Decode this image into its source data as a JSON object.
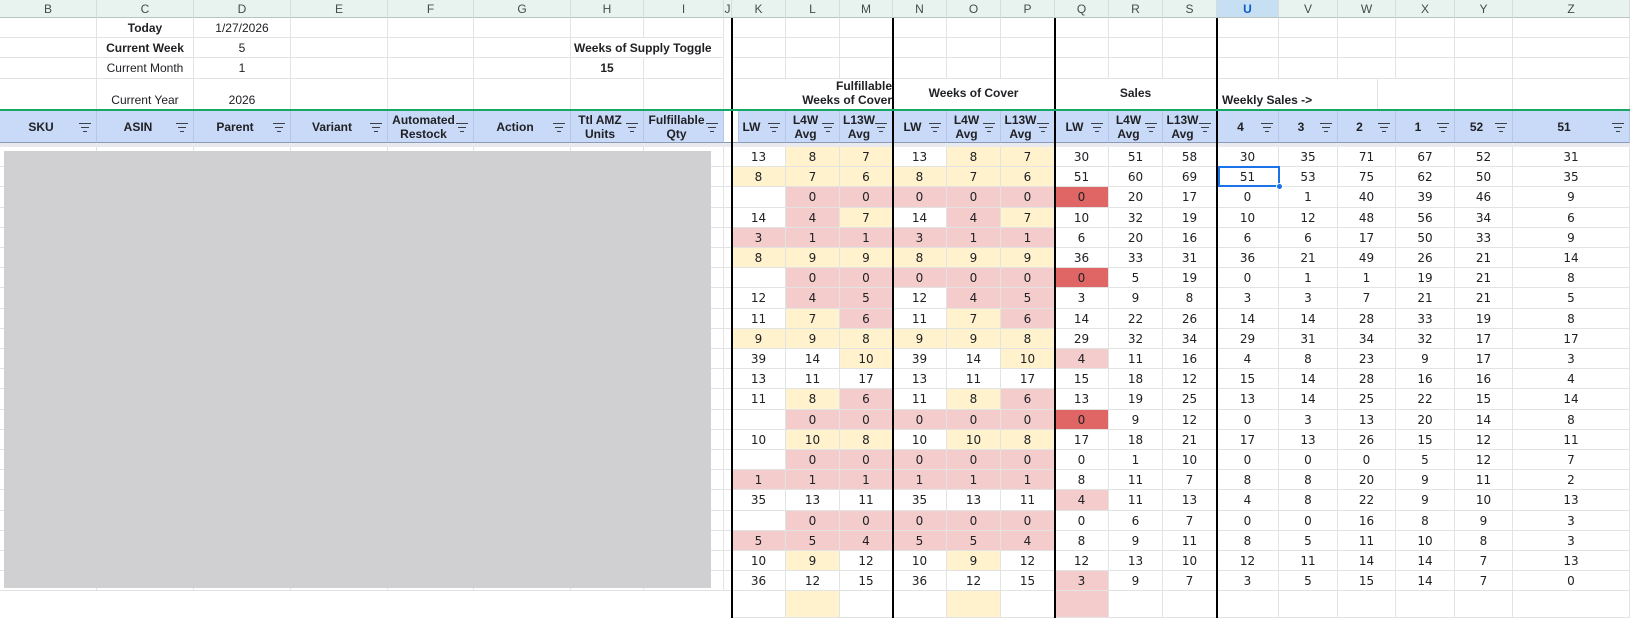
{
  "columns": [
    "B",
    "C",
    "D",
    "E",
    "F",
    "G",
    "H",
    "I",
    "J",
    "K",
    "L",
    "M",
    "N",
    "O",
    "P",
    "Q",
    "R",
    "S",
    "U",
    "V",
    "W",
    "X",
    "Y",
    "Z"
  ],
  "selected_column": "U",
  "info": {
    "today_label": "Today",
    "today_value": "1/27/2026",
    "week_label": "Current Week",
    "week_value": "5",
    "month_label": "Current Month",
    "month_value": "1",
    "year_label": "Current Year",
    "year_value": "2026",
    "wos_toggle_label": "Weeks of Supply Toggle",
    "wos_toggle_value": "15"
  },
  "groups": {
    "fulfillable_line1": "Fulfillable",
    "fulfillable_line2": "Weeks of Cover",
    "weeks_of_cover": "Weeks of Cover",
    "sales": "Sales",
    "weekly_sales": "Weekly Sales ->"
  },
  "headers": [
    {
      "col": "B",
      "label": "SKU"
    },
    {
      "col": "C",
      "label": "ASIN"
    },
    {
      "col": "D",
      "label": "Parent"
    },
    {
      "col": "E",
      "label": "Variant"
    },
    {
      "col": "F",
      "label": "Automated Restock"
    },
    {
      "col": "G",
      "label": "Action"
    },
    {
      "col": "H",
      "label": "Ttl AMZ Units"
    },
    {
      "col": "I",
      "label": "Fulfillable Qty"
    },
    {
      "col": "K",
      "label": "LW"
    },
    {
      "col": "L",
      "label": "L4W Avg"
    },
    {
      "col": "M",
      "label": "L13W Avg"
    },
    {
      "col": "N",
      "label": "LW"
    },
    {
      "col": "O",
      "label": "L4W Avg"
    },
    {
      "col": "P",
      "label": "L13W Avg"
    },
    {
      "col": "Q",
      "label": "LW"
    },
    {
      "col": "R",
      "label": "L4W Avg"
    },
    {
      "col": "S",
      "label": "L13W Avg"
    },
    {
      "col": "U",
      "label": "4"
    },
    {
      "col": "V",
      "label": "3"
    },
    {
      "col": "W",
      "label": "2"
    },
    {
      "col": "X",
      "label": "1"
    },
    {
      "col": "Y",
      "label": "52"
    },
    {
      "col": "Z",
      "label": "51"
    }
  ],
  "colors": {
    "yellow": "#fff2cc",
    "pink": "#f4cccc",
    "red": "#e06666",
    "header_blue": "#c9daf8",
    "selection": "#1a73e8"
  },
  "rows": [
    {
      "K": [
        "13",
        ""
      ],
      "L": [
        "8",
        "y"
      ],
      "M": [
        "7",
        "y"
      ],
      "N": [
        "13",
        ""
      ],
      "O": [
        "8",
        "y"
      ],
      "P": [
        "7",
        "y"
      ],
      "Q": [
        "30",
        ""
      ],
      "R": [
        "51",
        ""
      ],
      "S": [
        "58",
        ""
      ],
      "U": "30",
      "V": "35",
      "W": "71",
      "X": "67",
      "Y": "52",
      "Z": "31"
    },
    {
      "K": [
        "8",
        "y"
      ],
      "L": [
        "7",
        "y"
      ],
      "M": [
        "6",
        "y"
      ],
      "N": [
        "8",
        "y"
      ],
      "O": [
        "7",
        "y"
      ],
      "P": [
        "6",
        "y"
      ],
      "Q": [
        "51",
        ""
      ],
      "R": [
        "60",
        ""
      ],
      "S": [
        "69",
        ""
      ],
      "U": "51",
      "V": "53",
      "W": "75",
      "X": "62",
      "Y": "50",
      "Z": "35"
    },
    {
      "K": [
        "",
        ""
      ],
      "L": [
        "0",
        "r"
      ],
      "M": [
        "0",
        "r"
      ],
      "N": [
        "0",
        "r"
      ],
      "O": [
        "0",
        "r"
      ],
      "P": [
        "0",
        "r"
      ],
      "Q": [
        "0",
        "d"
      ],
      "R": [
        "20",
        ""
      ],
      "S": [
        "17",
        ""
      ],
      "U": "0",
      "V": "1",
      "W": "40",
      "X": "39",
      "Y": "46",
      "Z": "9"
    },
    {
      "K": [
        "14",
        ""
      ],
      "L": [
        "4",
        "r"
      ],
      "M": [
        "7",
        "y"
      ],
      "N": [
        "14",
        ""
      ],
      "O": [
        "4",
        "r"
      ],
      "P": [
        "7",
        "y"
      ],
      "Q": [
        "10",
        ""
      ],
      "R": [
        "32",
        ""
      ],
      "S": [
        "19",
        ""
      ],
      "U": "10",
      "V": "12",
      "W": "48",
      "X": "56",
      "Y": "34",
      "Z": "6"
    },
    {
      "K": [
        "3",
        "r"
      ],
      "L": [
        "1",
        "r"
      ],
      "M": [
        "1",
        "r"
      ],
      "N": [
        "3",
        "r"
      ],
      "O": [
        "1",
        "r"
      ],
      "P": [
        "1",
        "r"
      ],
      "Q": [
        "6",
        ""
      ],
      "R": [
        "20",
        ""
      ],
      "S": [
        "16",
        ""
      ],
      "U": "6",
      "V": "6",
      "W": "17",
      "X": "50",
      "Y": "33",
      "Z": "9"
    },
    {
      "K": [
        "8",
        "y"
      ],
      "L": [
        "9",
        "y"
      ],
      "M": [
        "9",
        "y"
      ],
      "N": [
        "8",
        "y"
      ],
      "O": [
        "9",
        "y"
      ],
      "P": [
        "9",
        "y"
      ],
      "Q": [
        "36",
        ""
      ],
      "R": [
        "33",
        ""
      ],
      "S": [
        "31",
        ""
      ],
      "U": "36",
      "V": "21",
      "W": "49",
      "X": "26",
      "Y": "21",
      "Z": "14"
    },
    {
      "K": [
        "",
        ""
      ],
      "L": [
        "0",
        "r"
      ],
      "M": [
        "0",
        "r"
      ],
      "N": [
        "0",
        "r"
      ],
      "O": [
        "0",
        "r"
      ],
      "P": [
        "0",
        "r"
      ],
      "Q": [
        "0",
        "d"
      ],
      "R": [
        "5",
        ""
      ],
      "S": [
        "19",
        ""
      ],
      "U": "0",
      "V": "1",
      "W": "1",
      "X": "19",
      "Y": "21",
      "Z": "8"
    },
    {
      "K": [
        "12",
        ""
      ],
      "L": [
        "4",
        "r"
      ],
      "M": [
        "5",
        "r"
      ],
      "N": [
        "12",
        ""
      ],
      "O": [
        "4",
        "r"
      ],
      "P": [
        "5",
        "r"
      ],
      "Q": [
        "3",
        ""
      ],
      "R": [
        "9",
        ""
      ],
      "S": [
        "8",
        ""
      ],
      "U": "3",
      "V": "3",
      "W": "7",
      "X": "21",
      "Y": "21",
      "Z": "5"
    },
    {
      "K": [
        "11",
        ""
      ],
      "L": [
        "7",
        "y"
      ],
      "M": [
        "6",
        "r"
      ],
      "N": [
        "11",
        ""
      ],
      "O": [
        "7",
        "y"
      ],
      "P": [
        "6",
        "r"
      ],
      "Q": [
        "14",
        ""
      ],
      "R": [
        "22",
        ""
      ],
      "S": [
        "26",
        ""
      ],
      "U": "14",
      "V": "14",
      "W": "28",
      "X": "33",
      "Y": "19",
      "Z": "8"
    },
    {
      "K": [
        "9",
        "y"
      ],
      "L": [
        "9",
        "y"
      ],
      "M": [
        "8",
        "y"
      ],
      "N": [
        "9",
        "y"
      ],
      "O": [
        "9",
        "y"
      ],
      "P": [
        "8",
        "y"
      ],
      "Q": [
        "29",
        ""
      ],
      "R": [
        "32",
        ""
      ],
      "S": [
        "34",
        ""
      ],
      "U": "29",
      "V": "31",
      "W": "34",
      "X": "32",
      "Y": "17",
      "Z": "17"
    },
    {
      "K": [
        "39",
        ""
      ],
      "L": [
        "14",
        ""
      ],
      "M": [
        "10",
        "y"
      ],
      "N": [
        "39",
        ""
      ],
      "O": [
        "14",
        ""
      ],
      "P": [
        "10",
        "y"
      ],
      "Q": [
        "4",
        "r"
      ],
      "R": [
        "11",
        ""
      ],
      "S": [
        "16",
        ""
      ],
      "U": "4",
      "V": "8",
      "W": "23",
      "X": "9",
      "Y": "17",
      "Z": "3"
    },
    {
      "K": [
        "13",
        ""
      ],
      "L": [
        "11",
        ""
      ],
      "M": [
        "17",
        ""
      ],
      "N": [
        "13",
        ""
      ],
      "O": [
        "11",
        ""
      ],
      "P": [
        "17",
        ""
      ],
      "Q": [
        "15",
        ""
      ],
      "R": [
        "18",
        ""
      ],
      "S": [
        "12",
        ""
      ],
      "U": "15",
      "V": "14",
      "W": "28",
      "X": "16",
      "Y": "16",
      "Z": "4"
    },
    {
      "K": [
        "11",
        ""
      ],
      "L": [
        "8",
        "y"
      ],
      "M": [
        "6",
        "r"
      ],
      "N": [
        "11",
        ""
      ],
      "O": [
        "8",
        "y"
      ],
      "P": [
        "6",
        "r"
      ],
      "Q": [
        "13",
        ""
      ],
      "R": [
        "19",
        ""
      ],
      "S": [
        "25",
        ""
      ],
      "U": "13",
      "V": "14",
      "W": "25",
      "X": "22",
      "Y": "15",
      "Z": "14"
    },
    {
      "K": [
        "",
        ""
      ],
      "L": [
        "0",
        "r"
      ],
      "M": [
        "0",
        "r"
      ],
      "N": [
        "0",
        "r"
      ],
      "O": [
        "0",
        "r"
      ],
      "P": [
        "0",
        "r"
      ],
      "Q": [
        "0",
        "d"
      ],
      "R": [
        "9",
        ""
      ],
      "S": [
        "12",
        ""
      ],
      "U": "0",
      "V": "3",
      "W": "13",
      "X": "20",
      "Y": "14",
      "Z": "8"
    },
    {
      "K": [
        "10",
        ""
      ],
      "L": [
        "10",
        "y"
      ],
      "M": [
        "8",
        "y"
      ],
      "N": [
        "10",
        ""
      ],
      "O": [
        "10",
        "y"
      ],
      "P": [
        "8",
        "y"
      ],
      "Q": [
        "17",
        ""
      ],
      "R": [
        "18",
        ""
      ],
      "S": [
        "21",
        ""
      ],
      "U": "17",
      "V": "13",
      "W": "26",
      "X": "15",
      "Y": "12",
      "Z": "11"
    },
    {
      "K": [
        "",
        ""
      ],
      "L": [
        "0",
        "r"
      ],
      "M": [
        "0",
        "r"
      ],
      "N": [
        "0",
        "r"
      ],
      "O": [
        "0",
        "r"
      ],
      "P": [
        "0",
        "r"
      ],
      "Q": [
        "0",
        ""
      ],
      "R": [
        "1",
        ""
      ],
      "S": [
        "10",
        ""
      ],
      "U": "0",
      "V": "0",
      "W": "0",
      "X": "5",
      "Y": "12",
      "Z": "7"
    },
    {
      "K": [
        "1",
        "r"
      ],
      "L": [
        "1",
        "r"
      ],
      "M": [
        "1",
        "r"
      ],
      "N": [
        "1",
        "r"
      ],
      "O": [
        "1",
        "r"
      ],
      "P": [
        "1",
        "r"
      ],
      "Q": [
        "8",
        ""
      ],
      "R": [
        "11",
        ""
      ],
      "S": [
        "7",
        ""
      ],
      "U": "8",
      "V": "8",
      "W": "20",
      "X": "9",
      "Y": "11",
      "Z": "2"
    },
    {
      "K": [
        "35",
        ""
      ],
      "L": [
        "13",
        ""
      ],
      "M": [
        "11",
        ""
      ],
      "N": [
        "35",
        ""
      ],
      "O": [
        "13",
        ""
      ],
      "P": [
        "11",
        ""
      ],
      "Q": [
        "4",
        "r"
      ],
      "R": [
        "11",
        ""
      ],
      "S": [
        "13",
        ""
      ],
      "U": "4",
      "V": "8",
      "W": "22",
      "X": "9",
      "Y": "10",
      "Z": "13"
    },
    {
      "K": [
        "",
        ""
      ],
      "L": [
        "0",
        "r"
      ],
      "M": [
        "0",
        "r"
      ],
      "N": [
        "0",
        "r"
      ],
      "O": [
        "0",
        "r"
      ],
      "P": [
        "0",
        "r"
      ],
      "Q": [
        "0",
        ""
      ],
      "R": [
        "6",
        ""
      ],
      "S": [
        "7",
        ""
      ],
      "U": "0",
      "V": "0",
      "W": "16",
      "X": "8",
      "Y": "9",
      "Z": "3"
    },
    {
      "K": [
        "5",
        "r"
      ],
      "L": [
        "5",
        "r"
      ],
      "M": [
        "4",
        "r"
      ],
      "N": [
        "5",
        "r"
      ],
      "O": [
        "5",
        "r"
      ],
      "P": [
        "4",
        "r"
      ],
      "Q": [
        "8",
        ""
      ],
      "R": [
        "9",
        ""
      ],
      "S": [
        "11",
        ""
      ],
      "U": "8",
      "V": "5",
      "W": "11",
      "X": "10",
      "Y": "8",
      "Z": "3"
    },
    {
      "K": [
        "10",
        ""
      ],
      "L": [
        "9",
        "y"
      ],
      "M": [
        "12",
        ""
      ],
      "N": [
        "10",
        ""
      ],
      "O": [
        "9",
        "y"
      ],
      "P": [
        "12",
        ""
      ],
      "Q": [
        "12",
        ""
      ],
      "R": [
        "13",
        ""
      ],
      "S": [
        "10",
        ""
      ],
      "U": "12",
      "V": "11",
      "W": "14",
      "X": "14",
      "Y": "7",
      "Z": "13"
    },
    {
      "K": [
        "36",
        ""
      ],
      "L": [
        "12",
        ""
      ],
      "M": [
        "15",
        ""
      ],
      "N": [
        "36",
        ""
      ],
      "O": [
        "12",
        ""
      ],
      "P": [
        "15",
        ""
      ],
      "Q": [
        "3",
        "r"
      ],
      "R": [
        "9",
        ""
      ],
      "S": [
        "7",
        ""
      ],
      "U": "3",
      "V": "5",
      "W": "15",
      "X": "14",
      "Y": "7",
      "Z": "0"
    }
  ]
}
